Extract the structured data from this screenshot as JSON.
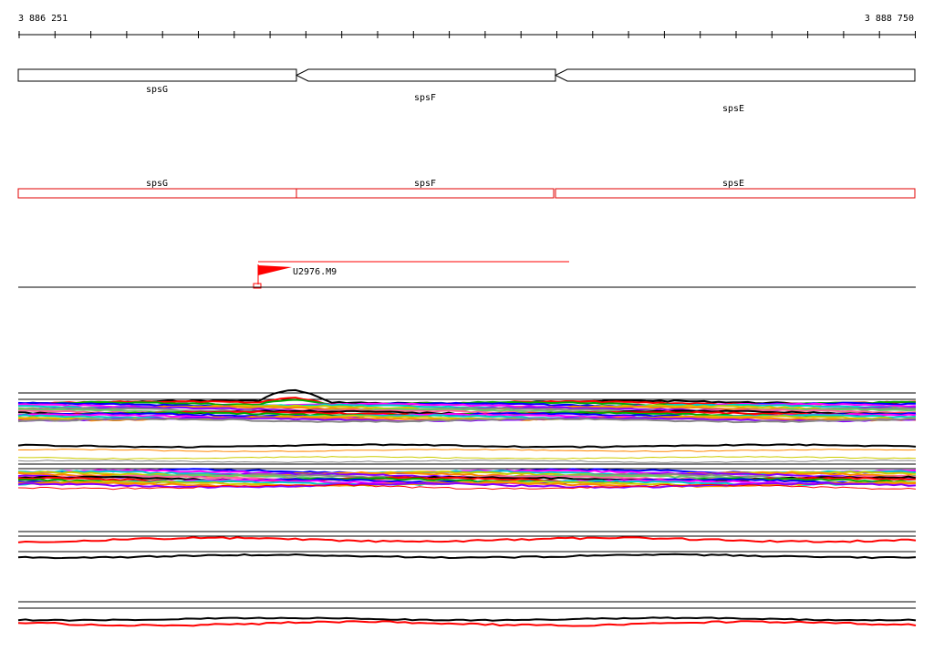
{
  "ruler": {
    "start_label": "3 886 251",
    "end_label": "3 888 750"
  },
  "genes": [
    {
      "name": "spsG",
      "strand": "-"
    },
    {
      "name": "spsF",
      "strand": "-"
    },
    {
      "name": "spsE",
      "strand": "-"
    }
  ],
  "operon_segments": [
    {
      "name": "spsG"
    },
    {
      "name": "spsF"
    },
    {
      "name": "spsE"
    }
  ],
  "feature_marker": {
    "label": "U2976.M9",
    "color": "#ff0000"
  },
  "track_colors": {
    "gene_outline": "#000000",
    "operon_outline": "#e00000",
    "marker": "#ff0000",
    "baseline": "#000000"
  },
  "expression_palette": [
    "#000000",
    "#ff0000",
    "#00aa00",
    "#0000ff",
    "#ff00ff",
    "#00cccc",
    "#cccc00",
    "#ff8800",
    "#8800ff",
    "#888888",
    "#66cc66",
    "#ff6699"
  ]
}
